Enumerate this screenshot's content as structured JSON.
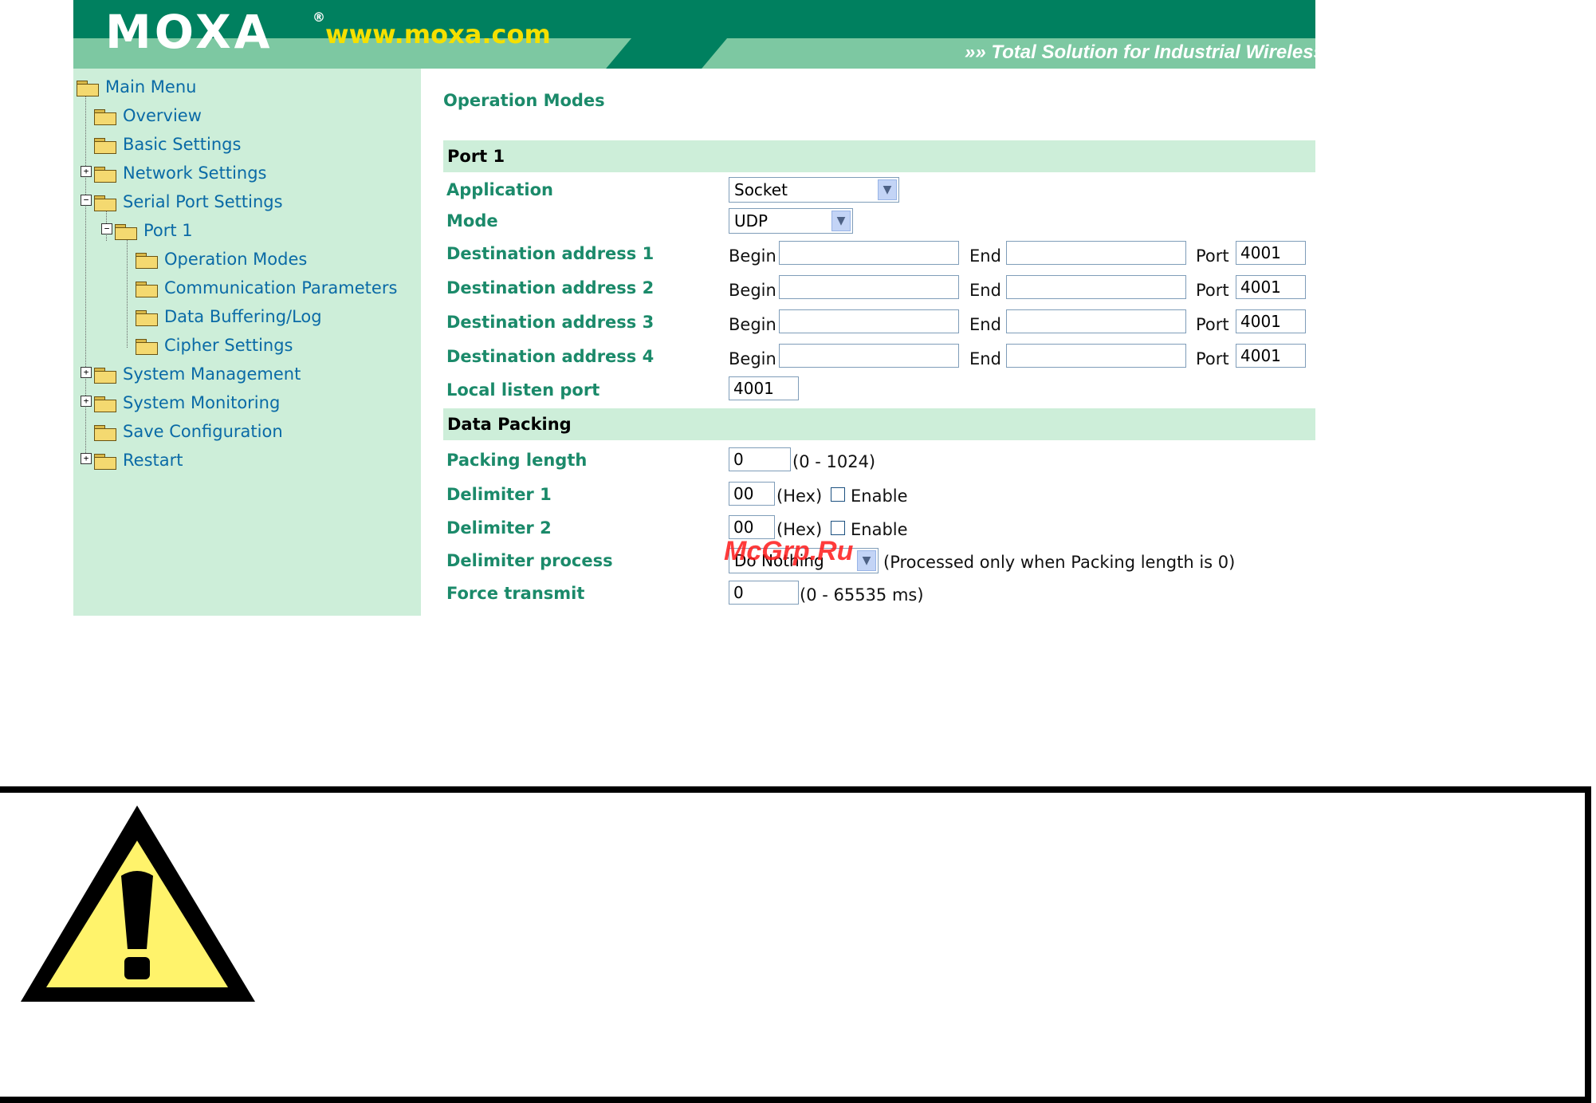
{
  "header": {
    "logo_text": "MOXA",
    "logo_registered": "®",
    "url": "www.moxa.com",
    "tagline": "»» Total Solution for Industrial Wireless Ne"
  },
  "sidebar": {
    "items": [
      {
        "label": "Main Menu"
      },
      {
        "label": "Overview"
      },
      {
        "label": "Basic Settings"
      },
      {
        "label": "Network Settings"
      },
      {
        "label": "Serial Port Settings"
      },
      {
        "label": "Port 1"
      },
      {
        "label": "Operation Modes"
      },
      {
        "label": "Communication Parameters"
      },
      {
        "label": "Data Buffering/Log"
      },
      {
        "label": "Cipher Settings"
      },
      {
        "label": "System Management"
      },
      {
        "label": "System Monitoring"
      },
      {
        "label": "Save Configuration"
      },
      {
        "label": "Restart"
      }
    ]
  },
  "main": {
    "title": "Operation Modes",
    "port_section": "Port 1",
    "application": {
      "label": "Application",
      "value": "Socket"
    },
    "mode": {
      "label": "Mode",
      "value": "UDP"
    },
    "destinations": [
      {
        "label": "Destination address 1",
        "begin": "",
        "end": "",
        "port": "4001"
      },
      {
        "label": "Destination address 2",
        "begin": "",
        "end": "",
        "port": "4001"
      },
      {
        "label": "Destination address 3",
        "begin": "",
        "end": "",
        "port": "4001"
      },
      {
        "label": "Destination address 4",
        "begin": "",
        "end": "",
        "port": "4001"
      }
    ],
    "begin_text": "Begin",
    "end_text": "End",
    "port_text": "Port",
    "local_listen_port": {
      "label": "Local listen port",
      "value": "4001"
    },
    "packing_section": "Data Packing",
    "packing_length": {
      "label": "Packing length",
      "value": "0",
      "hint": "(0 - 1024)"
    },
    "delimiter1": {
      "label": "Delimiter 1",
      "value": "00",
      "hint": "(Hex)",
      "enable_label": "Enable",
      "enabled": false
    },
    "delimiter2": {
      "label": "Delimiter 2",
      "value": "00",
      "hint": "(Hex)",
      "enable_label": "Enable",
      "enabled": false
    },
    "delimiter_process": {
      "label": "Delimiter process",
      "value": "Do Nothing",
      "hint": "(Processed only when Packing length is 0)"
    },
    "force_transmit": {
      "label": "Force transmit",
      "value": "0",
      "hint": "(0 - 65535 ms)"
    }
  },
  "watermark": "McGrp.Ru",
  "colors": {
    "banner_dark": "#00805f",
    "banner_light": "#7dc8a2",
    "url_yellow": "#f5e000",
    "sidebar_bg": "#cdeed9",
    "label_green": "#1b8a6a",
    "link_blue": "#0a6aa6",
    "warning_yellow": "#fff36b"
  }
}
